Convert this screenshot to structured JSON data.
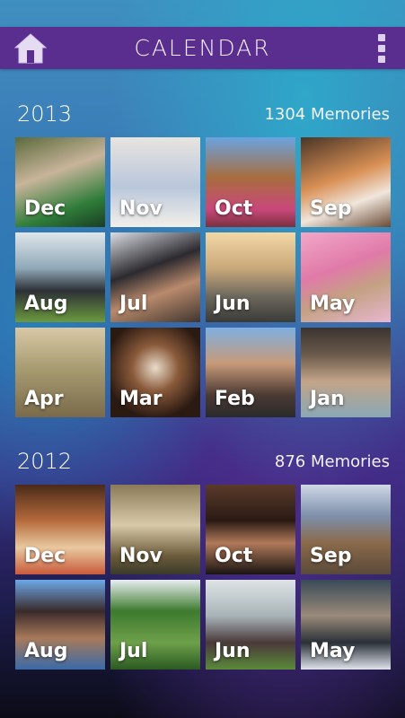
{
  "header": {
    "title": "CALENDAR"
  },
  "sections": [
    {
      "year": "2013",
      "count": "1304 Memories",
      "tiles": [
        {
          "month": "Dec",
          "bg": "linear-gradient(160deg,#5b6a3c 0%,#c8b49a 40%,#2f7d3a 75%,#1a3d22 100%)"
        },
        {
          "month": "Nov",
          "bg": "linear-gradient(180deg,#e8e4df 0%,#b9c7dc 55%,#f2efe9 100%)"
        },
        {
          "month": "Oct",
          "bg": "linear-gradient(180deg,#6aa3e0 0%,#a86d3e 45%,#c9487a 80%,#7a3040 100%)"
        },
        {
          "month": "Sep",
          "bg": "linear-gradient(160deg,#4a3526 0%,#d99055 45%,#f0e6dc 70%,#6a4a35 100%)"
        },
        {
          "month": "Aug",
          "bg": "linear-gradient(180deg,#dfe6ea 0%,#8fa8b8 40%,#2d3036 65%,#6b9a3e 100%)"
        },
        {
          "month": "Jul",
          "bg": "linear-gradient(160deg,#d9dde2 0%,#2c2a2f 40%,#b98a6c 65%,#40352f 100%)"
        },
        {
          "month": "Jun",
          "bg": "linear-gradient(180deg,#f3d8a6 0%,#c9a87a 40%,#6f6a5e 70%,#3a3a38 100%)"
        },
        {
          "month": "May",
          "bg": "linear-gradient(160deg,#f2a7c8 0%,#e07aa8 40%,#c4a183 65%,#e8b7d1 100%)"
        },
        {
          "month": "Apr",
          "bg": "linear-gradient(180deg,#d9c8a6 0%,#a89c72 45%,#7a6a4a 100%)"
        },
        {
          "month": "Mar",
          "bg": "radial-gradient(circle at 50% 45%,#e9dccb 0%,#8a5a3a 35%,#2b1a12 75%)"
        },
        {
          "month": "Feb",
          "bg": "linear-gradient(180deg,#7fb0e0 0%,#c79a78 40%,#4b3a33 75%,#2a2a2c 100%)"
        },
        {
          "month": "Jan",
          "bg": "linear-gradient(180deg,#3a3430 0%,#6b5a4b 30%,#c2a488 60%,#8aa8b6 100%)"
        }
      ]
    },
    {
      "year": "2012",
      "count": "876 Memories",
      "tiles": [
        {
          "month": "Dec",
          "bg": "linear-gradient(180deg,#4a2a1a 0%,#b56a3a 40%,#e9c9a0 70%,#c95a3a 100%)"
        },
        {
          "month": "Nov",
          "bg": "linear-gradient(180deg,#8a7a58 0%,#d8c9a8 45%,#6a5a3a 80%,#3a3a2a 100%)"
        },
        {
          "month": "Oct",
          "bg": "linear-gradient(180deg,#5a3a2a 0%,#2a1a14 40%,#b07a5a 65%,#1a1412 100%)"
        },
        {
          "month": "Sep",
          "bg": "linear-gradient(180deg,#cfd8e6 0%,#7d8faa 35%,#8a6a4a 65%,#5a4a3a 100%)"
        },
        {
          "month": "Aug",
          "bg": "linear-gradient(180deg,#6da8e8 0%,#3a2a2a 35%,#a87a5a 65%,#3a6aa8 100%)"
        },
        {
          "month": "Jul",
          "bg": "linear-gradient(180deg,#e8eef0 0%,#3d7a2e 35%,#6ea04a 70%,#2a5a22 100%)"
        },
        {
          "month": "Jun",
          "bg": "linear-gradient(180deg,#dfe4e6 0%,#a8b4b8 40%,#4a3a3a 70%,#5a8a3a 100%)"
        },
        {
          "month": "May",
          "bg": "linear-gradient(180deg,#3a4a58 0%,#9a8a7a 40%,#2a3038 70%,#dfe3ea 100%)"
        }
      ]
    }
  ]
}
